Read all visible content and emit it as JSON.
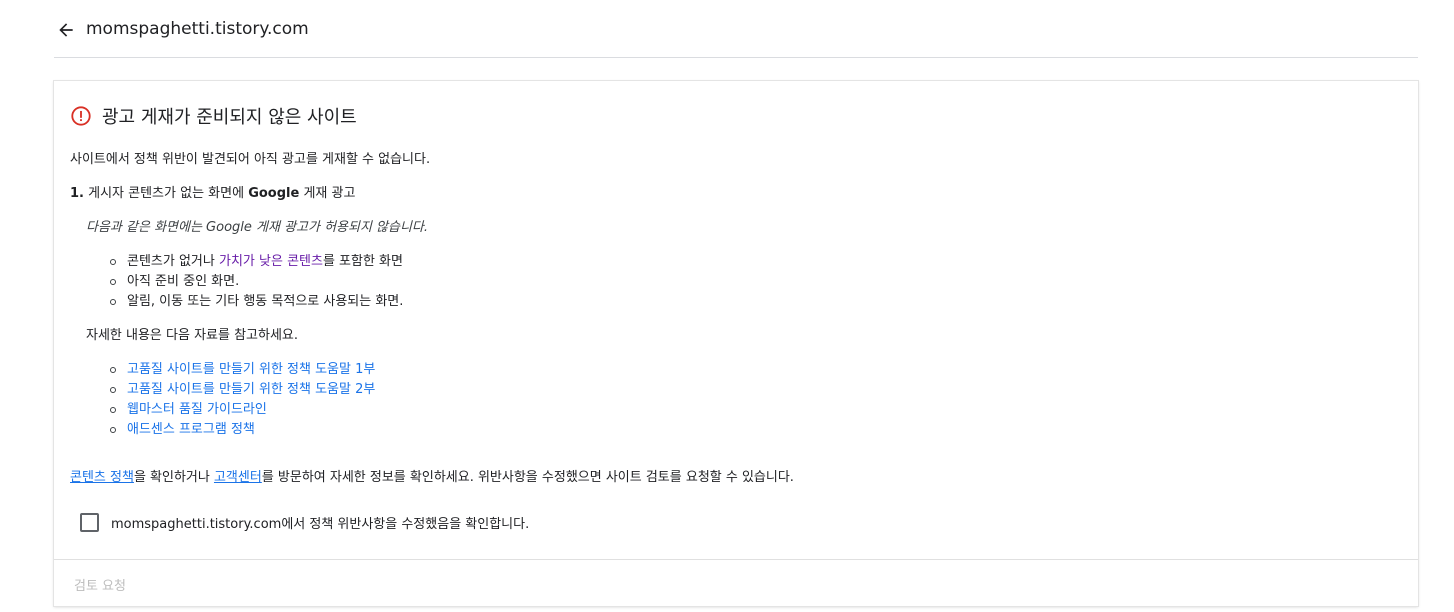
{
  "header": {
    "site": "momspaghetti.tistory.com",
    "back_icon": "arrow-left-icon"
  },
  "card": {
    "title_icon": "error-circle-icon",
    "title": "광고 게재가 준비되지 않은 사이트",
    "intro": "사이트에서 정책 위반이 발견되어 아직 광고를 게재할 수 없습니다.",
    "violation": {
      "number": "1.",
      "text_before": "게시자 콘텐츠가 없는 화면에 ",
      "text_brand": "Google",
      "text_after": " 게재 광고"
    },
    "policy_note": "다음과 같은 화면에는 Google 게재 광고가 허용되지 않습니다.",
    "screens": {
      "item1_prefix": "콘텐츠가 없거나 ",
      "item1_link": "가치가 낮은 콘텐츠",
      "item1_suffix": "를 포함한 화면",
      "item2": "아직 준비 중인 화면.",
      "item3": "알림, 이동 또는 기타 행동 목적으로 사용되는 화면."
    },
    "more_info": "자세한 내용은 다음 자료를 참고하세요.",
    "resources": [
      "고품질 사이트를 만들기 위한 정책 도움말 1부",
      "고품질 사이트를 만들기 위한 정책 도움말 2부",
      "웹마스터 품질 가이드라인",
      "애드센스 프로그램 정책"
    ],
    "footer_text": {
      "link1": "콘텐츠 정책",
      "mid1": "을 확인하거나 ",
      "link2": "고객센터",
      "rest": "를 방문하여 자세한 정보를 확인하세요. 위반사항을 수정했으면 사이트 검토를 요청할 수 있습니다."
    },
    "checkbox_label": "momspaghetti.tistory.com에서 정책 위반사항을 수정했음을 확인합니다.",
    "checkbox_checked": false,
    "review_button": "검토 요청"
  },
  "colors": {
    "error": "#d93025",
    "link": "#1a73e8",
    "visited_link": "#681da8",
    "disabled": "#bdbdbd"
  }
}
